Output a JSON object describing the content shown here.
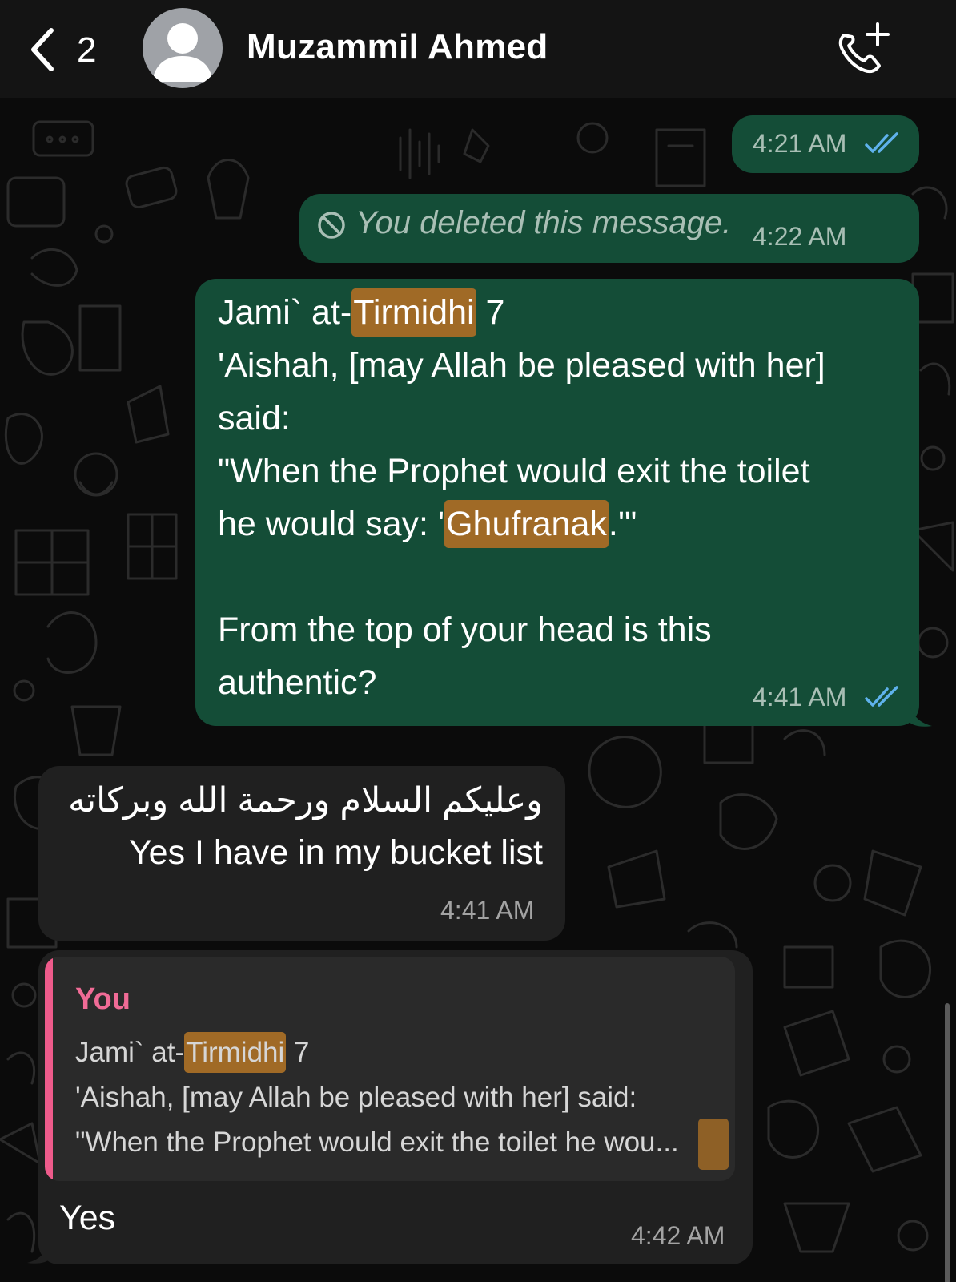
{
  "header": {
    "back_count": "2",
    "contact_name": "Muzammil Ahmed"
  },
  "messages": {
    "m1": {
      "time": "4:21 AM",
      "status": "read"
    },
    "m2": {
      "deleted_text": "You deleted this message.",
      "time": "4:22 AM"
    },
    "m3": {
      "l1a": "Jami` at-",
      "l1b": "Tirmidhi",
      "l1c": " 7",
      "l2": "'Aishah, [may Allah be pleased with her]",
      "l3": "said:",
      "l4": "\"When the Prophet would exit the toilet",
      "l5a": "he would say: '",
      "l5b": "Ghufranak",
      "l5c": ".'\"",
      "l6": "From the top of your head is this",
      "l7": "authentic?",
      "time": "4:41 AM",
      "status": "read"
    },
    "m4": {
      "arabic": "وعليكم السلام ورحمة الله وبركاته",
      "line2": "Yes I have in my bucket list",
      "time": "4:41 AM"
    },
    "m5": {
      "quote_author": "You",
      "q1a": "Jami` at-",
      "q1b": "Tirmidhi",
      "q1c": " 7",
      "q2": "'Aishah, [may Allah be pleased with her] said:",
      "q3": "\"When the Prophet would exit the toilet he wou...",
      "text": "Yes",
      "time": "4:42 AM"
    }
  },
  "colors": {
    "outgoing_bubble": "#144d37",
    "incoming_bubble": "#202020",
    "highlight": "#a06a26",
    "read_ticks": "#5fb2ec",
    "quote_accent": "#ee5b8b"
  }
}
